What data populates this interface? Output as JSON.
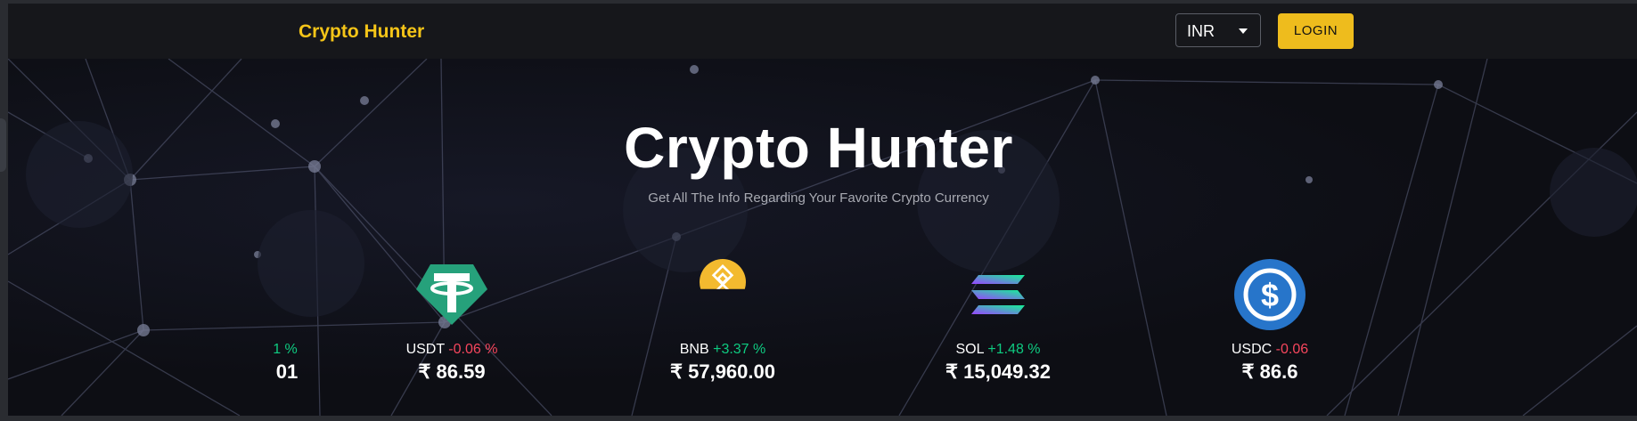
{
  "navbar": {
    "brand": "Crypto Hunter",
    "currency": {
      "selected": "INR"
    },
    "login_label": "LOGIN"
  },
  "hero": {
    "title": "Crypto Hunter",
    "subtitle": "Get All The Info Regarding Your Favorite Crypto Currency"
  },
  "carousel": {
    "items": [
      {
        "symbol": "",
        "change": "1 %",
        "price": "01",
        "direction": "up",
        "icon": "partial-coin-icon"
      },
      {
        "symbol": "USDT",
        "change": "-0.06 %",
        "price": "₹ 86.59",
        "direction": "down",
        "icon": "tether-icon"
      },
      {
        "symbol": "BNB",
        "change": "+3.37 %",
        "price": "₹ 57,960.00",
        "direction": "up",
        "icon": "bnb-icon"
      },
      {
        "symbol": "SOL",
        "change": "+1.48 %",
        "price": "₹ 15,049.32",
        "direction": "up",
        "icon": "solana-icon"
      },
      {
        "symbol": "USDC",
        "change": "-0.06",
        "price": "₹ 86.6",
        "direction": "down",
        "icon": "usdc-icon"
      }
    ]
  },
  "colors": {
    "accent": "#eebc1d",
    "brand": "#f5c518",
    "positive": "#0ecb81",
    "negative": "#f6465d",
    "background": "#0d0e14"
  }
}
